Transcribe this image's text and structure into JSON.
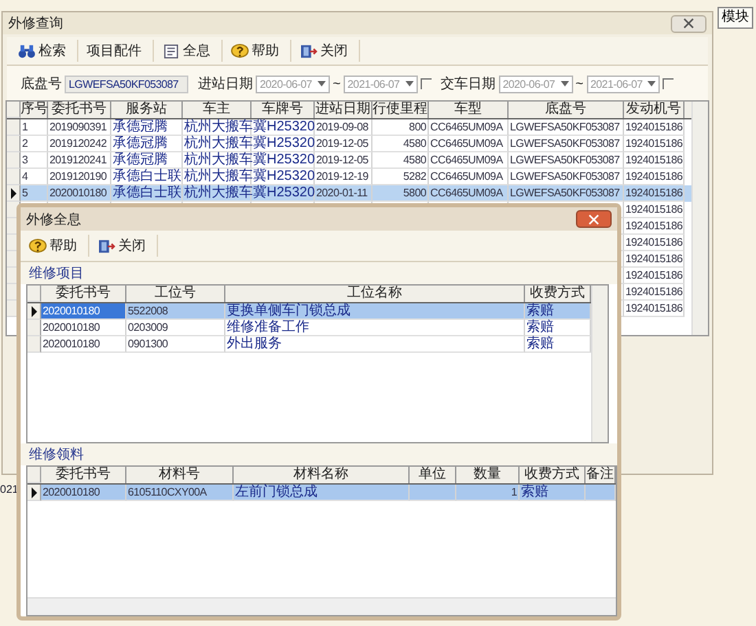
{
  "background": {
    "button": "模块",
    "text": "021"
  },
  "main_window": {
    "title": "外修查询",
    "toolbar": [
      {
        "label": "检索",
        "kind": "binoculars"
      },
      {
        "label": "项目配件",
        "kind": "plain"
      },
      {
        "label": "全息",
        "kind": "document"
      },
      {
        "label": "帮助",
        "kind": "help"
      },
      {
        "label": "关闭",
        "kind": "exit"
      }
    ],
    "filters": {
      "chassis_label": "底盘号",
      "chassis_value": "LGWEFSA50KF053087",
      "ranges": [
        {
          "label": "进站日期",
          "from": "2020-06-07",
          "separator": "~",
          "to": "2021-06-07",
          "disabled": true,
          "checked": false
        },
        {
          "label": "交车日期",
          "from": "2020-06-07",
          "separator": "~",
          "to": "2021-06-07",
          "disabled": true,
          "checked": false
        }
      ]
    },
    "table": {
      "columns": [
        "序号",
        "委托书号",
        "服务站",
        "车主",
        "车牌号",
        "进站日期",
        "行使里程",
        "车型",
        "底盘号",
        "发动机号"
      ],
      "rows": [
        {
          "selected": false,
          "cells": [
            "1",
            "2019090391",
            "承德冠腾",
            "杭州大搬车",
            "冀H25320",
            "2019-09-08",
            "800",
            "CC6465UM09A",
            "LGWEFSA50KF053087",
            "1924015186"
          ]
        },
        {
          "selected": false,
          "cells": [
            "2",
            "2019120242",
            "承德冠腾",
            "杭州大搬车",
            "冀H25320",
            "2019-12-05",
            "4580",
            "CC6465UM09A",
            "LGWEFSA50KF053087",
            "1924015186"
          ]
        },
        {
          "selected": false,
          "cells": [
            "3",
            "2019120241",
            "承德冠腾",
            "杭州大搬车",
            "冀H25320",
            "2019-12-05",
            "4580",
            "CC6465UM09A",
            "LGWEFSA50KF053087",
            "1924015186"
          ]
        },
        {
          "selected": false,
          "cells": [
            "4",
            "2019120190",
            "承德白士联",
            "杭州大搬车",
            "冀H25320",
            "2019-12-19",
            "5282",
            "CC6465UM09A",
            "LGWEFSA50KF053087",
            "1924015186"
          ]
        },
        {
          "selected": true,
          "cells": [
            "5",
            "2020010180",
            "承德白士联",
            "杭州大搬车",
            "冀H25320",
            "2020-01-11",
            "5800",
            "CC6465UM09A",
            "LGWEFSA50KF053087",
            "1924015186"
          ]
        },
        {
          "selected": false,
          "engine_no": "1924015186"
        },
        {
          "selected": false,
          "engine_no": "1924015186"
        },
        {
          "selected": false,
          "engine_no": "1924015186"
        },
        {
          "selected": false,
          "engine_no": "1924015186"
        },
        {
          "selected": false,
          "engine_no": "1924015186"
        },
        {
          "selected": false,
          "engine_no": "1924015186"
        },
        {
          "selected": false,
          "engine_no": "1924015186"
        }
      ]
    }
  },
  "popup": {
    "title": "外修全息",
    "toolbar": [
      {
        "label": "帮助",
        "kind": "help"
      },
      {
        "label": "关闭",
        "kind": "exit"
      }
    ],
    "items": {
      "title": "维修项目",
      "columns": [
        "委托书号",
        "工位号",
        "工位名称",
        "收费方式"
      ],
      "rows": [
        {
          "selected": true,
          "cells": [
            "2020010180",
            "5522008",
            "更换单侧车门锁总成",
            "索赔"
          ]
        },
        {
          "selected": false,
          "cells": [
            "2020010180",
            "0203009",
            "维修准备工作",
            "索赔"
          ]
        },
        {
          "selected": false,
          "cells": [
            "2020010180",
            "0901300",
            "外出服务",
            "索赔"
          ]
        }
      ]
    },
    "materials": {
      "title": "维修领料",
      "columns": [
        "委托书号",
        "材料号",
        "材料名称",
        "单位",
        "数量",
        "收费方式",
        "备注"
      ],
      "rows": [
        {
          "selected": true,
          "order_no": "2020010180",
          "material_no": "6105110CXY00A",
          "material_name": "左前门锁总成",
          "quantity": "1",
          "charge_method": "索赔"
        }
      ]
    }
  }
}
